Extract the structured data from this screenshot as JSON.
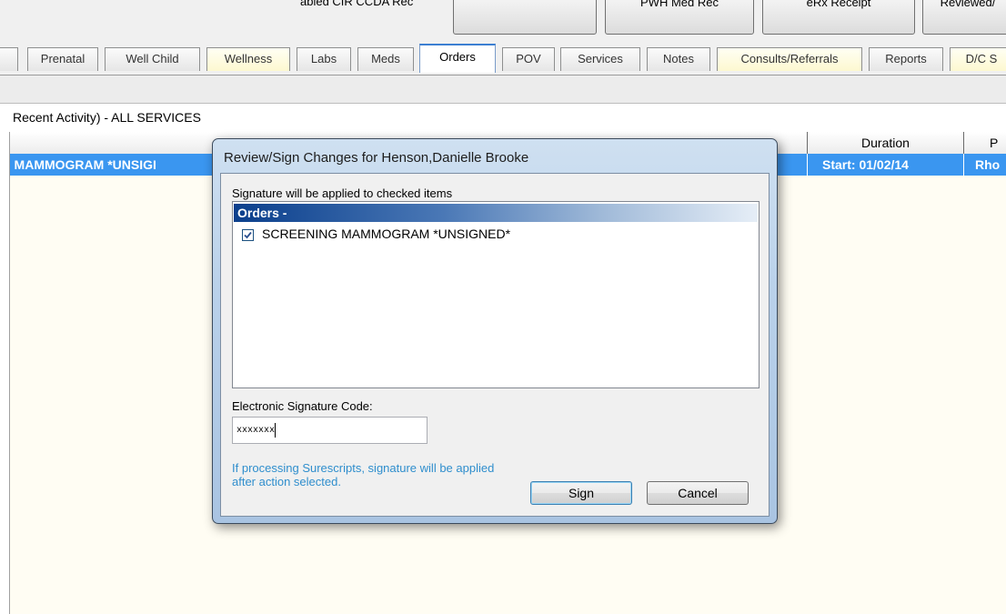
{
  "toolbar": {
    "partial_label": "abled CIR CCDA Rec",
    "buttons": [
      "",
      "PWH Med Rec",
      "eRx Receipt",
      "Reviewed/"
    ]
  },
  "tabs": [
    {
      "label": "Prenatal"
    },
    {
      "label": "Well Child"
    },
    {
      "label": "Wellness"
    },
    {
      "label": "Labs"
    },
    {
      "label": "Meds"
    },
    {
      "label": "Orders",
      "active": true
    },
    {
      "label": "POV"
    },
    {
      "label": "Services"
    },
    {
      "label": "Notes"
    },
    {
      "label": "Consults/Referrals"
    },
    {
      "label": "Reports"
    },
    {
      "label": "D/C S"
    }
  ],
  "list_title": "Recent Activity) - ALL SERVICES",
  "grid": {
    "columns": [
      "",
      "Duration",
      "P"
    ],
    "row": {
      "order": "; MAMMOGRAM *UNSIGI",
      "duration": "Start: 01/02/14",
      "provider": "Rho"
    }
  },
  "dialog": {
    "title": "Review/Sign Changes for Henson,Danielle Brooke",
    "signature_message": "Signature will be applied to checked items",
    "orders_header": "Orders -",
    "items": [
      {
        "label": "SCREENING MAMMOGRAM *UNSIGNED*",
        "checked": true
      }
    ],
    "esig_label": "Electronic Signature Code:",
    "esig_value": "xxxxxxx",
    "surescripts_note": "If processing Surescripts, signature will be applied after action selected.",
    "sign_label": "Sign",
    "cancel_label": "Cancel"
  },
  "colors": {
    "selection": "#3a96f0",
    "note_text": "#2f8ecd",
    "orders_header_start": "#0b3f8c",
    "active_tab_accent": "#3c7fd2"
  },
  "icons": {
    "check": "checkmark-icon"
  }
}
